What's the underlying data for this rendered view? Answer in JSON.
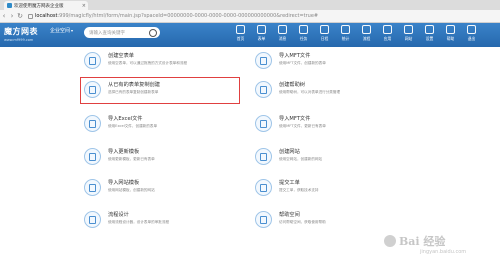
{
  "browser": {
    "tab_title": "欢迎使用魔方网表企业版",
    "tab_close": "×",
    "url_host": "localhost",
    "url_rest": ":999/magicfly/html/form/main.jsp?spaceId=00000000-0000-0000-0000-000000000000&redirect=true#"
  },
  "header": {
    "logo": "魔方网表",
    "logo_sub": "www.mf999.com",
    "site": "企业空间",
    "search_placeholder": "请输入查询关键字",
    "tools": [
      {
        "label": "首页",
        "icon": "home-icon"
      },
      {
        "label": "表单",
        "icon": "form-icon"
      },
      {
        "label": "消息",
        "icon": "message-icon"
      },
      {
        "label": "任务",
        "icon": "task-icon"
      },
      {
        "label": "日程",
        "icon": "calendar-icon"
      },
      {
        "label": "统计",
        "icon": "stats-icon"
      },
      {
        "label": "流程",
        "icon": "flow-icon"
      },
      {
        "label": "应用",
        "icon": "app-icon"
      },
      {
        "label": "网站",
        "icon": "website-icon"
      },
      {
        "label": "设置",
        "icon": "settings-icon"
      },
      {
        "label": "帮助",
        "icon": "help-icon"
      },
      {
        "label": "退出",
        "icon": "exit-icon"
      }
    ]
  },
  "cards_left": [
    {
      "title": "创建空表单",
      "desc": "使用空表单，可以通过拖拽的方式设计表单和流程"
    },
    {
      "title": "从已有的表单复制创建",
      "desc": "选择已有的表单复制创建新表单"
    },
    {
      "title": "导入Excel文件",
      "desc": "使用Excel文件，创建新的表单"
    },
    {
      "title": "导入更新模板",
      "desc": "使用更新模板，更新已有表单"
    },
    {
      "title": "导入网站模板",
      "desc": "使用网站模板，创建新的网站"
    },
    {
      "title": "流程设计",
      "desc": "使用流程设计器，设计表单的审批流程"
    }
  ],
  "cards_right": [
    {
      "title": "导入MFT文件",
      "desc": "使用MFT文件，创建新的表单"
    },
    {
      "title": "创建帮助树",
      "desc": "使用帮助树，可以对表单进行分类管理"
    },
    {
      "title": "导入MFT文件",
      "desc": "使用MFT文件，更新已有表单"
    },
    {
      "title": "创建网站",
      "desc": "使用空网站，创建新的网站"
    },
    {
      "title": "提交工单",
      "desc": "提交工单，获取技术支持"
    },
    {
      "title": "帮助空间",
      "desc": "访问帮助空间，获取使用帮助"
    }
  ],
  "watermark": {
    "brand": "Bai 经验",
    "url": "jingyan.baidu.com"
  }
}
